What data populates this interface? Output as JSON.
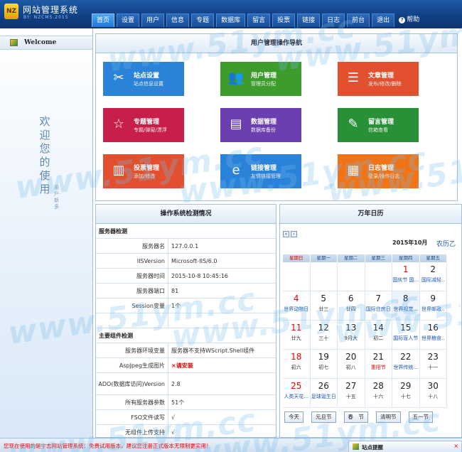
{
  "header": {
    "logo_text": "NZ",
    "title": "网站管理系统",
    "subtitle": "BY: NZCMS.2015"
  },
  "nav": {
    "items": [
      "首页",
      "设置",
      "用户",
      "信息",
      "专题",
      "数据库",
      "留言",
      "投票",
      "链接",
      "日志",
      "前台",
      "退出"
    ],
    "help": "帮助"
  },
  "sidebar": {
    "welcome": "Welcome",
    "welcome_vertical": "欢迎您的使用",
    "welcome_small": "用户·新多"
  },
  "nav_panel": {
    "title": "用户管理操作导航",
    "tiles": [
      {
        "name": "站点设置",
        "desc": "站点信息设置",
        "color": "#2b82d9",
        "icon": "tools-icon",
        "glyph": "✂"
      },
      {
        "name": "用户管理",
        "desc": "管理员分配",
        "color": "#3d9c2c",
        "icon": "users-icon",
        "glyph": "👥"
      },
      {
        "name": "文章管理",
        "desc": "发布/修改/删除",
        "color": "#e2502f",
        "icon": "article-icon",
        "glyph": "☰"
      },
      {
        "name": "专题管理",
        "desc": "专题/弹窗/漂浮",
        "color": "#c71e4a",
        "icon": "star-icon",
        "glyph": "☆"
      },
      {
        "name": "数据管理",
        "desc": "数据库备份",
        "color": "#6c3fb0",
        "icon": "database-icon",
        "glyph": "▤"
      },
      {
        "name": "留言管理",
        "desc": "信箱查看",
        "color": "#289036",
        "icon": "message-icon",
        "glyph": "✎"
      },
      {
        "name": "投票管理",
        "desc": "添加/修改",
        "color": "#e2502f",
        "icon": "chart-icon",
        "glyph": "▥"
      },
      {
        "name": "链接管理",
        "desc": "友情链接管理",
        "color": "#2b82d9",
        "icon": "link-icon",
        "glyph": "e"
      },
      {
        "name": "日志管理",
        "desc": "登录/操作日志",
        "color": "#f07316",
        "icon": "calendar-icon",
        "glyph": "▦"
      }
    ]
  },
  "sys_panel": {
    "title": "操作系统检测情况",
    "server_section": "服务器检测",
    "server_rows": [
      {
        "k": "服务器名",
        "v": "127.0.0.1"
      },
      {
        "k": "IISVersion",
        "v": "Microsoft-IIS/6.0"
      },
      {
        "k": "服务器时间",
        "v": "2015-10-8 10:45:16"
      },
      {
        "k": "服务器端口",
        "v": "81"
      },
      {
        "k": "Session变量",
        "v": "1个"
      },
      {
        "k": "",
        "v": ""
      }
    ],
    "component_section": "主要组件检测",
    "component_rows": [
      {
        "k": "服务器环境变量",
        "v": "服务器不支持WScript.Shell组件"
      },
      {
        "k": "AspJpeg生成图片",
        "v": "×请安装",
        "red": true
      },
      {
        "k": "ADO(数据库访问)Version",
        "v": "2.8",
        "tall": true
      },
      {
        "k": "所有服务器参数",
        "v": "51个"
      },
      {
        "k": "FSO文件读写",
        "v": "√"
      },
      {
        "k": "无组件上传支持",
        "v": "√"
      }
    ]
  },
  "calendar": {
    "title": "万年日历",
    "prev_year": "«",
    "prev_month": "‹",
    "month": "2015年10月",
    "lunar_link": "农历乙",
    "weekdays": [
      "星期日",
      "星期一",
      "星期二",
      "星期三",
      "星期四",
      "星期五"
    ],
    "weeks": [
      [
        {
          "d": "",
          "l": ""
        },
        {
          "d": "",
          "l": ""
        },
        {
          "d": "",
          "l": ""
        },
        {
          "d": "",
          "l": ""
        },
        {
          "d": "1",
          "l": "国庆节 国...",
          "dred": true,
          "lc": "blue"
        },
        {
          "d": "2",
          "l": "国际减轻..",
          "lc": "blue"
        }
      ],
      [
        {
          "d": "4",
          "l": "世界动物日",
          "dred": true,
          "lc": "blue"
        },
        {
          "d": "5",
          "l": "廿三"
        },
        {
          "d": "6",
          "l": "廿四"
        },
        {
          "d": "7",
          "l": "国际住房日",
          "lc": "blue"
        },
        {
          "d": "8",
          "l": "世界视觉...",
          "lc": "blue",
          "today": true
        },
        {
          "d": "9",
          "l": "世界邮政..",
          "lc": "blue"
        }
      ],
      [
        {
          "d": "11",
          "l": "廿九",
          "dred": true
        },
        {
          "d": "12",
          "l": "三十"
        },
        {
          "d": "13",
          "l": "9月大"
        },
        {
          "d": "14",
          "l": "初二"
        },
        {
          "d": "15",
          "l": "国际盲人节",
          "lc": "blue"
        },
        {
          "d": "16",
          "l": "世界粮食..",
          "lc": "blue"
        }
      ],
      [
        {
          "d": "18",
          "l": "初六",
          "dred": true
        },
        {
          "d": "19",
          "l": "初七"
        },
        {
          "d": "20",
          "l": "初八"
        },
        {
          "d": "21",
          "l": "重阳节",
          "lc": "red"
        },
        {
          "d": "22",
          "l": "世界传统...",
          "lc": "blue"
        },
        {
          "d": "23",
          "l": "十一"
        }
      ],
      [
        {
          "d": "25",
          "l": "人类天花...",
          "dred": true,
          "lc": "blue"
        },
        {
          "d": "26",
          "l": "足球诞生日",
          "lc": "blue"
        },
        {
          "d": "27",
          "l": "十五"
        },
        {
          "d": "28",
          "l": "十六"
        },
        {
          "d": "29",
          "l": "十七"
        },
        {
          "d": "30",
          "l": "十八"
        }
      ]
    ],
    "buttons": [
      "今天",
      "元旦节",
      "春　节",
      "清明节",
      "五一节"
    ]
  },
  "watermark": "www.51ym.cc",
  "footer": {
    "message": "您现在使用的是宁志网站管理系统：免费试用版本，建议您注册正式版本无限制更实用！",
    "tip_title": "站点提醒",
    "tip_close": "×"
  }
}
